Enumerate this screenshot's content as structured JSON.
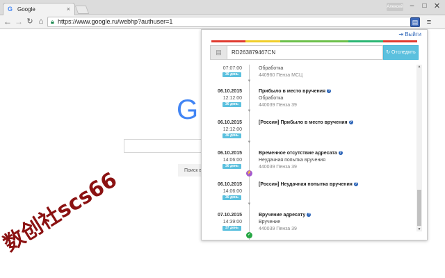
{
  "browser": {
    "tab_title": "Google",
    "tab_favicon": "G",
    "user_label": "Алексей",
    "url": "https://www.google.ru/webhp?authuser=1"
  },
  "google": {
    "logo_partial": "G",
    "search_button_partial": "Поиск в"
  },
  "watermark": "数创社scs66",
  "popup": {
    "logout_label": "Выйти",
    "colorbar": [
      "#e03a2f",
      "#e03a2f",
      "#f0ce2a",
      "#f0ce2a",
      "#6cc04a",
      "#6cc04a",
      "#6cc04a",
      "#6cc04a",
      "#2bb673",
      "#2bb673",
      "#e03a2f",
      "#e03a2f"
    ],
    "tracking_number": "RD263879467CN",
    "track_button": "Отследить",
    "events": [
      {
        "date": "",
        "time": "07:07:00",
        "days": "36 день",
        "title": "",
        "status": "Обработка",
        "address": "440960 Пенза МСЦ",
        "marker": "arrow"
      },
      {
        "date": "06.10.2015",
        "time": "12:12:00",
        "days": "36 день",
        "title": "Прибыло в место вручения",
        "status": "Обработка",
        "address": "440039 Пенза 39",
        "marker": "arrow"
      },
      {
        "date": "06.10.2015",
        "time": "12:12:00",
        "days": "36 день",
        "title": "[Россия] Прибыло в место вручения",
        "status": "",
        "address": "",
        "marker": "arrow"
      },
      {
        "date": "06.10.2015",
        "time": "14:06:00",
        "days": "36 день",
        "title": "Временное отсутствие адресата",
        "status": "Неудачная попытка вручения",
        "address": "440039 Пенза 39",
        "marker": "bolt"
      },
      {
        "date": "06.10.2015",
        "time": "14:06:00",
        "days": "36 день",
        "title": "[Россия] Неудачная попытка вручения",
        "status": "",
        "address": "",
        "marker": "arrow"
      },
      {
        "date": "07.10.2015",
        "time": "14:39:00",
        "days": "37 день",
        "title": "Вручение адресату",
        "status": "Вручение",
        "address": "440039 Пенза 39",
        "marker": "check"
      }
    ]
  }
}
